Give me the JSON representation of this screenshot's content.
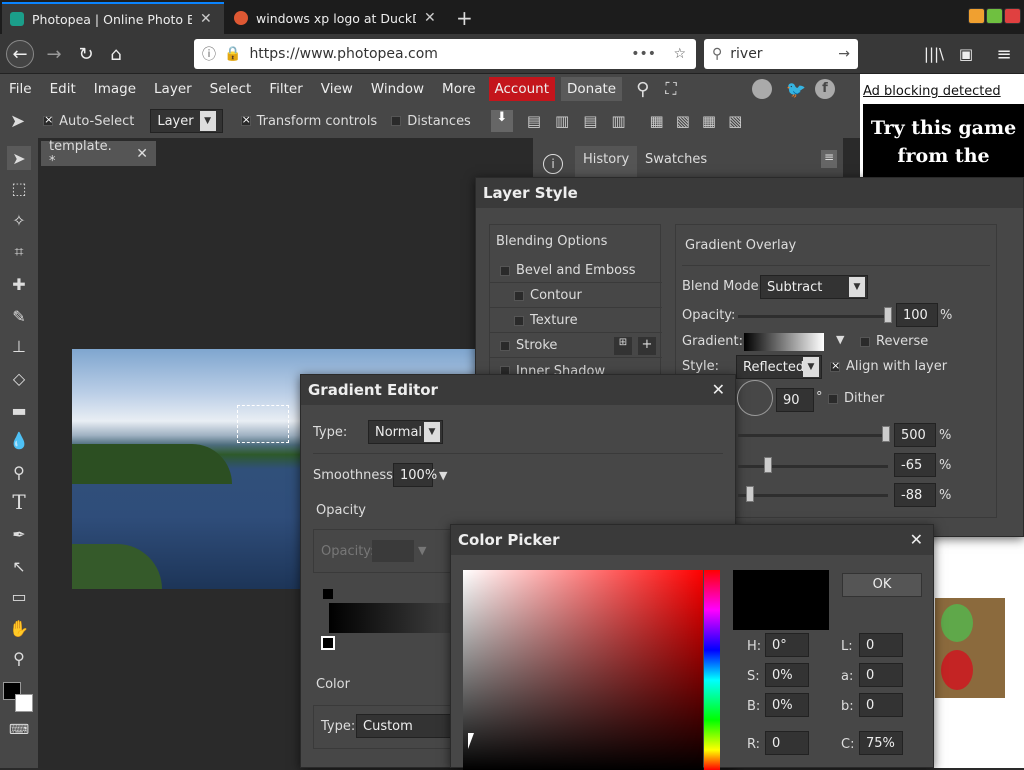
{
  "browser": {
    "tabs": [
      {
        "title": "Photopea | Online Photo Edit",
        "active": true
      },
      {
        "title": "windows xp logo at DuckDuc",
        "active": false
      }
    ],
    "url": "https://www.photopea.com",
    "search_value": "river"
  },
  "menu": {
    "items": [
      "File",
      "Edit",
      "Image",
      "Layer",
      "Select",
      "Filter",
      "View",
      "Window",
      "More"
    ],
    "account": "Account",
    "donate": "Donate"
  },
  "ad": {
    "link": "Ad blocking detected",
    "line1": "Try this game",
    "line2": "from the"
  },
  "options": {
    "auto_select": "Auto-Select",
    "layer_select": "Layer",
    "transform_controls": "Transform controls",
    "distances": "Distances"
  },
  "document_tab": "template. *",
  "panel_tabs": [
    "History",
    "Swatches"
  ],
  "layer_style": {
    "title": "Layer Style",
    "blending_options": "Blending Options",
    "effects": [
      "Bevel and Emboss",
      "Contour",
      "Texture",
      "Stroke",
      "Inner Shadow"
    ],
    "section": "Gradient Overlay",
    "blend_mode_label": "Blend Mode:",
    "blend_mode": "Subtract",
    "opacity_label": "Opacity:",
    "opacity": "100",
    "gradient_label": "Gradient:",
    "reverse": "Reverse",
    "style_label": "Style:",
    "style": "Reflected",
    "align_with_layer": "Align with layer",
    "angle": "90",
    "angle_unit": "°",
    "dither": "Dither",
    "scale": "500",
    "offset_x": "-65",
    "offset_y": "-88",
    "percent": "%"
  },
  "gradient_editor": {
    "title": "Gradient Editor",
    "type_label": "Type:",
    "type": "Normal",
    "smoothness_label": "Smoothness:",
    "smoothness": "100%",
    "opacity_section": "Opacity",
    "opacity_label": "Opacity:",
    "color_section": "Color",
    "color_type_label": "Type:",
    "color_type": "Custom"
  },
  "color_picker": {
    "title": "Color Picker",
    "ok": "OK",
    "fields": [
      {
        "label": "H:",
        "value": "0°"
      },
      {
        "label": "S:",
        "value": "0%"
      },
      {
        "label": "B:",
        "value": "0%"
      },
      {
        "label": "R:",
        "value": "0"
      },
      {
        "label": "L:",
        "value": "0"
      },
      {
        "label": "a:",
        "value": "0"
      },
      {
        "label": "b:",
        "value": "0"
      },
      {
        "label": "C:",
        "value": "75%"
      }
    ]
  }
}
